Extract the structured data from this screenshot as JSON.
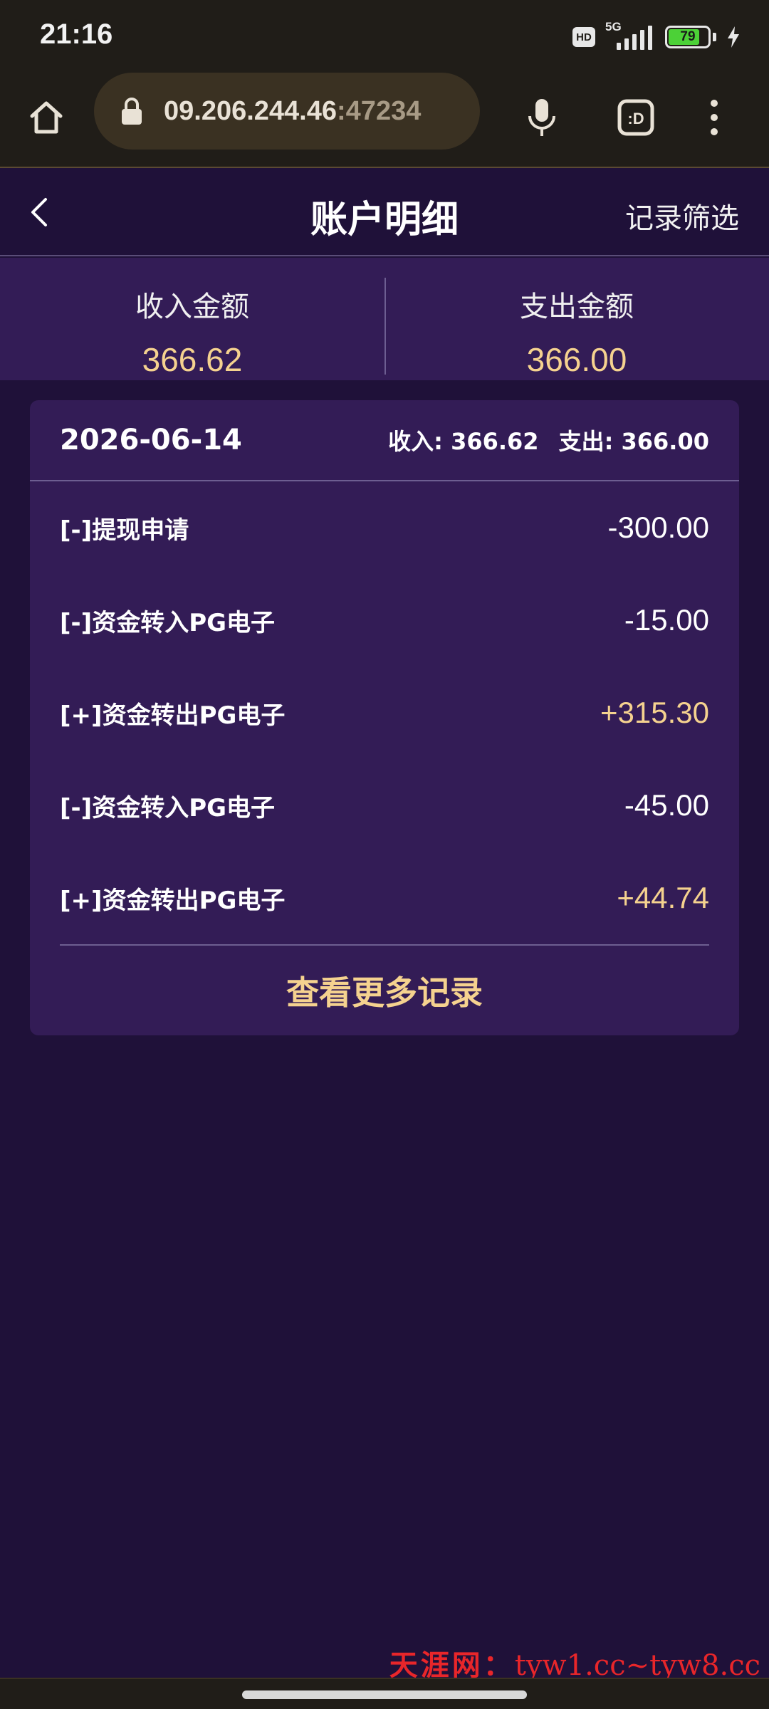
{
  "status_bar": {
    "time": "21:16",
    "hd": "HD",
    "network": "5G",
    "battery": 79,
    "battery_label": "79",
    "icons": [
      "hd-icon",
      "signal-icon",
      "battery-icon",
      "charging-icon"
    ]
  },
  "browser": {
    "url_main": "09.206.244.46",
    "url_port": ":47234",
    "tab_label": ":D",
    "icons": [
      "home-icon",
      "lock-icon",
      "mic-icon",
      "tab-switcher-icon",
      "more-menu-icon"
    ]
  },
  "header": {
    "title": "账户明细",
    "filter": "记录筛选",
    "back_icon": "chevron-left-icon"
  },
  "summary": {
    "income_label": "收入金额",
    "income_value": "366.62",
    "expense_label": "支出金额",
    "expense_value": "366.00"
  },
  "card": {
    "date": "2026-06-14",
    "income_text": "收入: 366.62",
    "expense_text": "支出: 366.00",
    "rows": [
      {
        "label": "[-]提现申请",
        "amount": "-300.00"
      },
      {
        "label": "[-]资金转入PG电子",
        "amount": "-15.00"
      },
      {
        "label": "[+]资金转出PG电子",
        "amount": "+315.30"
      },
      {
        "label": "[-]资金转入PG电子",
        "amount": "-45.00"
      },
      {
        "label": "[+]资金转出PG电子",
        "amount": "+44.74"
      }
    ],
    "more": "查看更多记录"
  },
  "watermark": {
    "brand": "天涯网：",
    "domains": "tyw1.cc~tyw8.cc"
  },
  "colors": {
    "background": "#1f1139",
    "panel": "#331c56",
    "accent_gold": "#f5d28f",
    "browser_chrome": "#201d18"
  }
}
